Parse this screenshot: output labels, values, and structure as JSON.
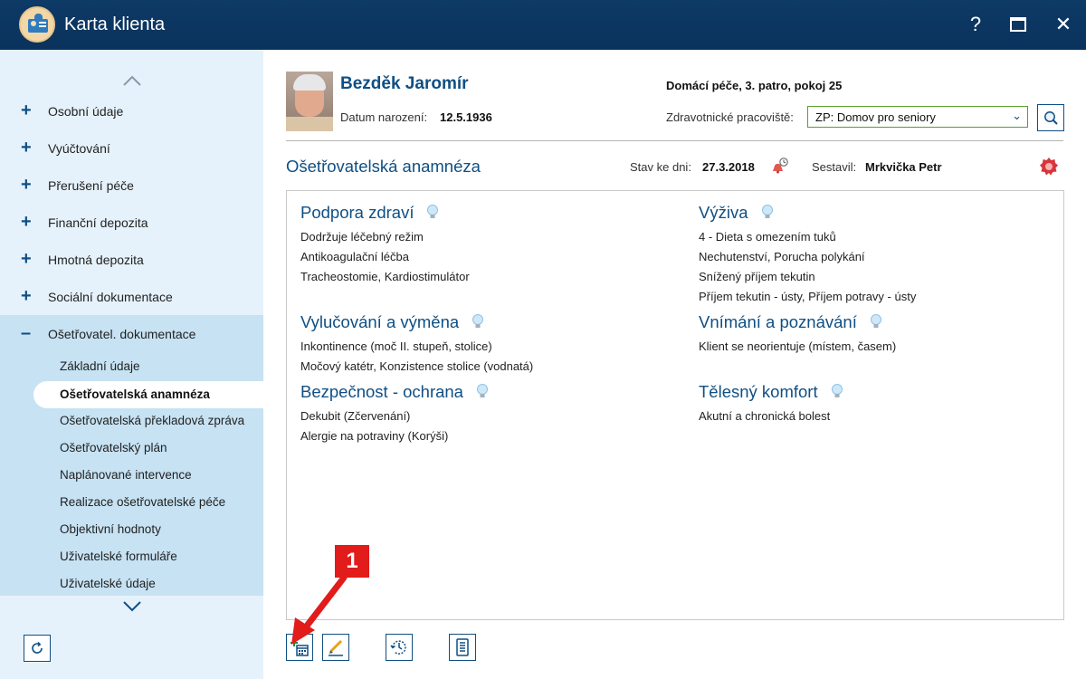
{
  "window": {
    "title": "Karta klienta",
    "help_glyph": "?",
    "close_glyph": "✕"
  },
  "sidebar": {
    "items": [
      {
        "sign": "+",
        "label": "Osobní údaje"
      },
      {
        "sign": "+",
        "label": "Vyúčtování"
      },
      {
        "sign": "+",
        "label": "Přerušení péče"
      },
      {
        "sign": "+",
        "label": "Finanční depozita"
      },
      {
        "sign": "+",
        "label": "Hmotná depozita"
      },
      {
        "sign": "+",
        "label": "Sociální dokumentace"
      },
      {
        "sign": "–",
        "label": "Ošetřovatel. dokumentace"
      }
    ],
    "subitems": [
      "Základní údaje",
      "Ošetřovatelská anamnéza",
      "Ošetřovatelská překladová zpráva",
      "Ošetřovatelský plán",
      "Naplánované intervence",
      "Realizace ošetřovatelské péče",
      "Objektivní hodnoty",
      "Uživatelské formuláře",
      "Uživatelské údaje"
    ],
    "active_subitem_index": 1
  },
  "patient": {
    "name": "Bezděk Jaromír",
    "dob_label": "Datum narození:",
    "dob": "12.5.1936",
    "location": "Domácí péče, 3. patro, pokoj 25",
    "workplace_label": "Zdravotnické pracoviště:",
    "workplace": "ZP: Domov pro seniory"
  },
  "section": {
    "title": "Ošetřovatelská anamnéza",
    "state_label": "Stav ke dni:",
    "state_date": "27.3.2018",
    "author_label": "Sestavil:",
    "author": "Mrkvička Petr"
  },
  "categories": [
    {
      "title": "Podpora zdraví",
      "lines": [
        "Dodržuje léčebný režim",
        "Antikoagulační léčba",
        "Tracheostomie, Kardiostimulátor"
      ]
    },
    {
      "title": "Výživa",
      "lines": [
        "4 - Dieta s omezením tuků",
        "Nechutenství, Porucha polykání",
        "Snížený příjem tekutin",
        "Příjem tekutin - ústy, Příjem potravy - ústy"
      ]
    },
    {
      "title": "Vylučování a výměna",
      "lines": [
        "Inkontinence (moč II. stupeň, stolice)",
        "Močový katétr, Konzistence stolice (vodnatá)"
      ]
    },
    {
      "title": "Vnímání a poznávání",
      "lines": [
        "Klient se neorientuje (místem, časem)"
      ]
    },
    {
      "title": "Bezpečnost - ochrana",
      "lines": [
        "Dekubit (Zčervenání)",
        "Alergie na potraviny (Korýši)"
      ]
    },
    {
      "title": "Tělesný komfort",
      "lines": [
        "Akutní a chronická bolest"
      ]
    }
  ],
  "annotation": {
    "marker": "1"
  },
  "colors": {
    "titlebar": "#0e3a67",
    "accent": "#0f4f84",
    "sidebar": "#e6f2fb",
    "sidebar_active": "#c6e2f3",
    "marker": "#e21b1b"
  }
}
